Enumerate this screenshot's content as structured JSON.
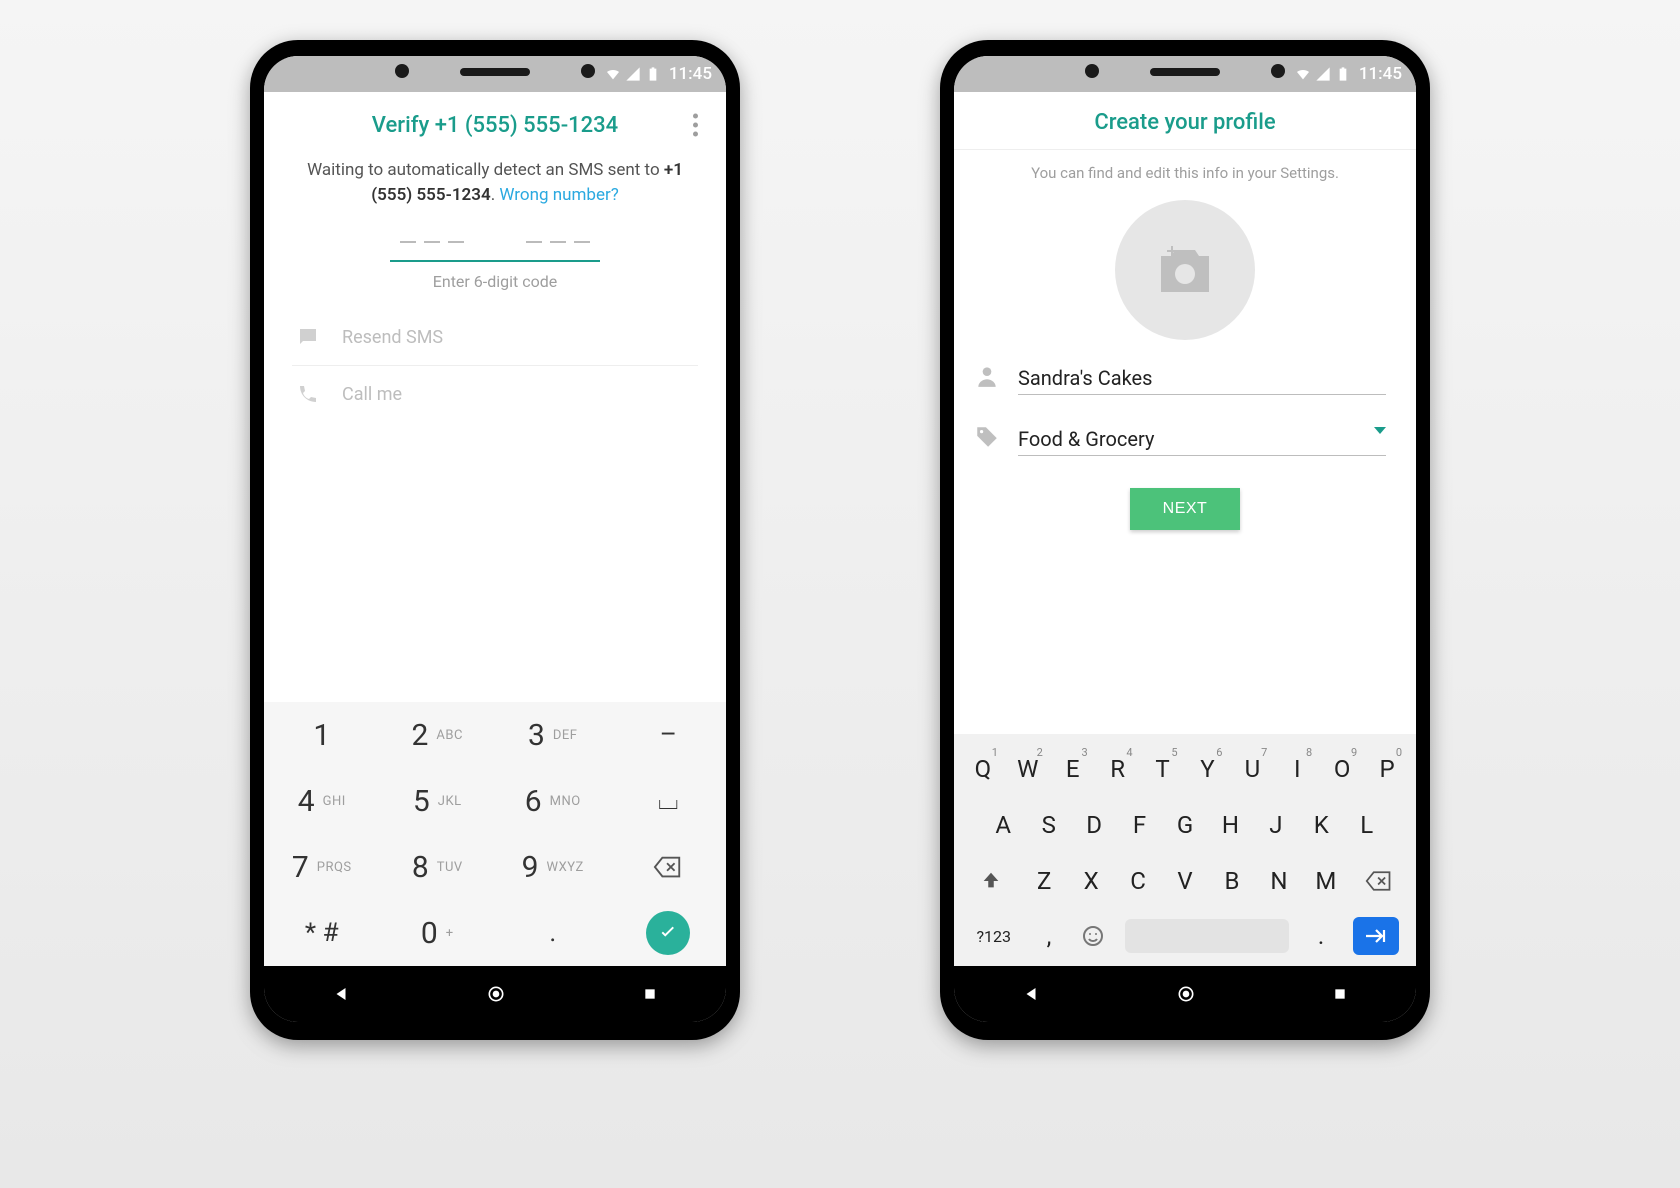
{
  "status": {
    "time": "11:45"
  },
  "left": {
    "title": "Verify +1 (555) 555-1234",
    "waiting_prefix": "Waiting to automatically detect an SMS sent to ",
    "phone_number": "+1 (555) 555-1234",
    "period": ". ",
    "wrong_number": "Wrong number?",
    "enter_code_hint": "Enter 6-digit code",
    "resend_sms": "Resend SMS",
    "call_me": "Call me",
    "dialpad": {
      "k1": "1",
      "k2": "2",
      "k2s": "ABC",
      "k3": "3",
      "k3s": "DEF",
      "k4": "4",
      "k4s": "GHI",
      "k5": "5",
      "k5s": "JKL",
      "k6": "6",
      "k6s": "MNO",
      "k7": "7",
      "k7s": "PRQS",
      "k8": "8",
      "k8s": "TUV",
      "k9": "9",
      "k9s": "WXYZ",
      "kstar": "* #",
      "k0": "0",
      "k0s": "+",
      "kdot": "."
    }
  },
  "right": {
    "title": "Create your profile",
    "subtitle": "You can find and edit this info in your Settings.",
    "name_value": "Sandra's Cakes",
    "category_value": "Food & Grocery",
    "next_label": "NEXT",
    "qwerty": {
      "row1": [
        "Q",
        "W",
        "E",
        "R",
        "T",
        "Y",
        "U",
        "I",
        "O",
        "P"
      ],
      "row1n": [
        "1",
        "2",
        "3",
        "4",
        "5",
        "6",
        "7",
        "8",
        "9",
        "0"
      ],
      "row2": [
        "A",
        "S",
        "D",
        "F",
        "G",
        "H",
        "J",
        "K",
        "L"
      ],
      "row3": [
        "Z",
        "X",
        "C",
        "V",
        "B",
        "N",
        "M"
      ],
      "sym": "?123",
      "comma": ",",
      "period": "."
    }
  }
}
